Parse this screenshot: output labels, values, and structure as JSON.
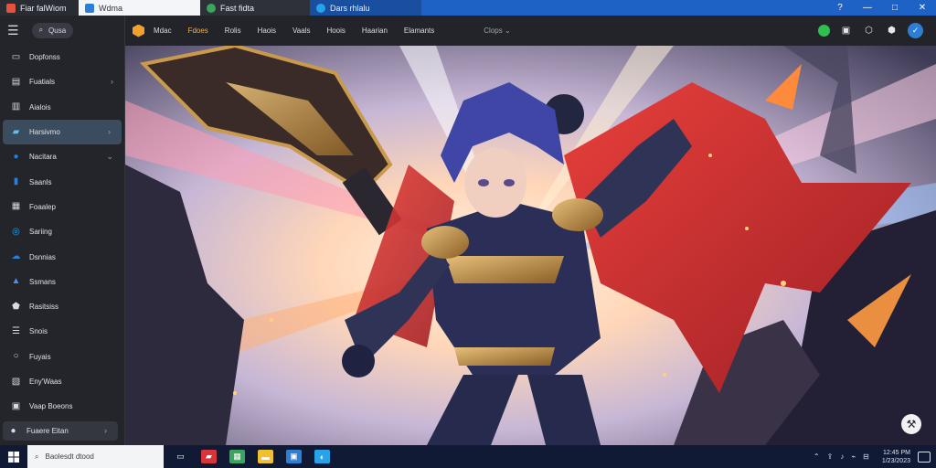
{
  "tabs": [
    {
      "label": "Fiar falWiom",
      "icon": "game-icon",
      "color": "#e5533d"
    },
    {
      "label": "Wdma",
      "icon": "page-icon",
      "color": "#2b7fd6"
    },
    {
      "label": "Fast fidta",
      "icon": "browser-icon",
      "color": "#3aa55d"
    },
    {
      "label": "Dars rhlalu",
      "icon": "edge-icon",
      "color": "#29a3e8"
    }
  ],
  "window_controls": {
    "help": "?",
    "minimize": "—",
    "maximize": "□",
    "close": "✕"
  },
  "sidebar": {
    "search_label": "Qusa",
    "items": [
      {
        "label": "Dopfonss",
        "icon": "document-icon",
        "glyph": "▭",
        "color": "#d7dbe2",
        "chevron": ""
      },
      {
        "label": "Fuatials",
        "icon": "inbox-icon",
        "glyph": "▤",
        "color": "#d7dbe2",
        "chevron": "›"
      },
      {
        "label": "Aialois",
        "icon": "tray-icon",
        "glyph": "▥",
        "color": "#d7dbe2",
        "chevron": ""
      },
      {
        "label": "Harsivmo",
        "icon": "tag-icon",
        "glyph": "▰",
        "color": "#5ec1ee",
        "chevron": "›"
      },
      {
        "label": "Nacitara",
        "icon": "chat-icon",
        "glyph": "●",
        "color": "#2b7fd6",
        "chevron": "⌄"
      },
      {
        "label": "Saanls",
        "icon": "bookmark-icon",
        "glyph": "▮",
        "color": "#2b7fd6",
        "chevron": ""
      },
      {
        "label": "Foaalep",
        "icon": "photos-icon",
        "glyph": "▦",
        "color": "#d7dbe2",
        "chevron": ""
      },
      {
        "label": "Sariing",
        "icon": "refresh-icon",
        "glyph": "◎",
        "color": "#29a3e8",
        "chevron": ""
      },
      {
        "label": "Dsnnias",
        "icon": "cloud-icon",
        "glyph": "☁",
        "color": "#2b7fd6",
        "chevron": ""
      },
      {
        "label": "Ssmans",
        "icon": "shape-icon",
        "glyph": "▲",
        "color": "#4b8ff0",
        "chevron": ""
      },
      {
        "label": "Rasitsiss",
        "icon": "shield-icon",
        "glyph": "⬟",
        "color": "#d7dbe2",
        "chevron": ""
      },
      {
        "label": "Snois",
        "icon": "list-icon",
        "glyph": "☰",
        "color": "#d7dbe2",
        "chevron": ""
      },
      {
        "label": "Fuyais",
        "icon": "search-icon",
        "glyph": "○",
        "color": "#d7dbe2",
        "chevron": ""
      },
      {
        "label": "Eny'Waas",
        "icon": "image-icon",
        "glyph": "▧",
        "color": "#d7dbe2",
        "chevron": ""
      },
      {
        "label": "Vaap Boeons",
        "icon": "stack-icon",
        "glyph": "▣",
        "color": "#d7dbe2",
        "chevron": ""
      }
    ],
    "footer": {
      "label": "Fuaere Eitan",
      "chevron": "›"
    }
  },
  "topnav": {
    "items": [
      "Mdac",
      "Fdoes",
      "Rolis",
      "Haois",
      "Vaals",
      "Hoois",
      "Haarian",
      "Elamants"
    ],
    "accent_index": 1,
    "dropdown": "Clops ⌄"
  },
  "top_right": {
    "tweet": "✓"
  },
  "fab_glyph": "⚒",
  "taskbar": {
    "search_label": "Baolesdt dtood",
    "apps": [
      {
        "name": "taskview-icon",
        "color": "transparent",
        "glyph": "▭"
      },
      {
        "name": "mail-icon",
        "color": "#d8353a",
        "glyph": "▰"
      },
      {
        "name": "store-icon",
        "color": "#3aa55d",
        "glyph": "▦"
      },
      {
        "name": "folder-icon",
        "color": "#f0c030",
        "glyph": "▬"
      },
      {
        "name": "window-icon",
        "color": "#2b7fd6",
        "glyph": "▣"
      },
      {
        "name": "edge-icon",
        "color": "#29a3e8",
        "glyph": "◐"
      }
    ],
    "tray": [
      "⌃",
      "⇪",
      "♪",
      "⌁",
      "⊟"
    ],
    "clock_time": "12:45 PM",
    "clock_date": "1/23/2023"
  }
}
